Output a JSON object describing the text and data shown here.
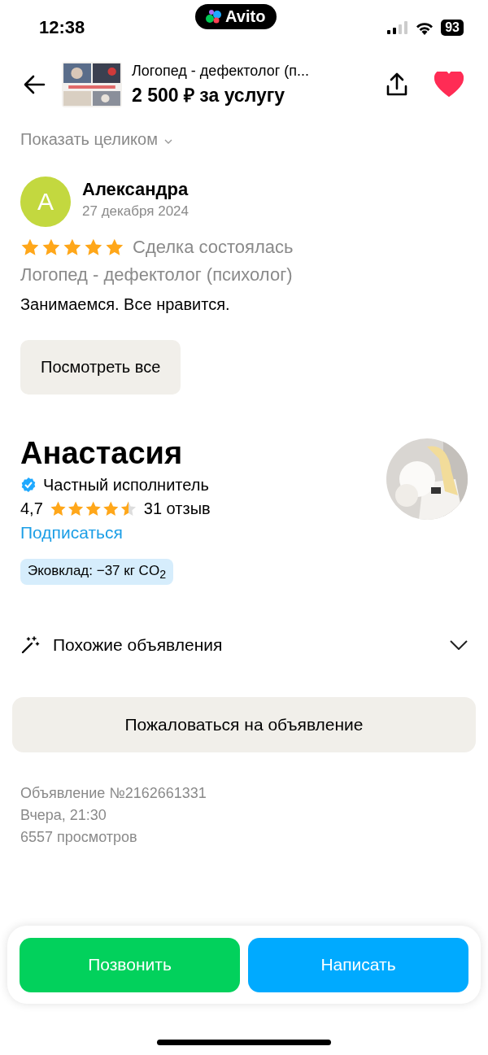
{
  "status_bar": {
    "time": "12:38",
    "app_pill": "Avito",
    "battery": "93"
  },
  "header": {
    "title": "Логопед - дефектолог (п...",
    "price": "2 500 ₽ за услугу",
    "favorite": true
  },
  "description": {
    "expand_link": "Показать целиком"
  },
  "review": {
    "avatar_letter": "А",
    "author": "Александра",
    "date": "27 декабря 2024",
    "stars": 5,
    "status": "Сделка состоялась",
    "service": "Логопед - дефектолог (психолог)",
    "text": "Занимаемся. Все нравится."
  },
  "see_all_button": "Посмотреть все",
  "seller": {
    "name": "Анастасия",
    "type": "Частный исполнитель",
    "rating": "4,7",
    "stars": 4.5,
    "reviews": "31 отзыв",
    "subscribe": "Подписаться",
    "eco_badge": "Эковклад: −37 кг CO$_{2}$"
  },
  "similar": {
    "label": "Похожие объявления",
    "expanded": false
  },
  "report_button": "Пожаловаться на объявление",
  "meta": [
    "Объявление №2162661331",
    "Вчера, 21:30",
    "6557 просмотров"
  ],
  "actions": [
    {
      "label": "Позвонить",
      "kind": "call"
    },
    {
      "label": "Написать",
      "kind": "message"
    }
  ]
}
